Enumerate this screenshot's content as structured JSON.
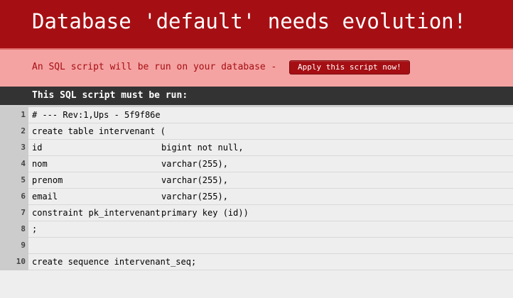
{
  "header": {
    "title": "Database 'default' needs evolution!"
  },
  "notice": {
    "message": "An SQL script will be run on your database -",
    "apply_button_label": "Apply this script now!"
  },
  "script": {
    "title": "This SQL script must be run:",
    "lines": [
      {
        "number": "1",
        "text": "# --- Rev:1,Ups - 5f9f86e",
        "col2": ""
      },
      {
        "number": "2",
        "text": "create table intervenant (",
        "col2": ""
      },
      {
        "number": "3",
        "text": "id",
        "col2": "bigint not null,"
      },
      {
        "number": "4",
        "text": "nom",
        "col2": "varchar(255),"
      },
      {
        "number": "5",
        "text": "prenom",
        "col2": "varchar(255),"
      },
      {
        "number": "6",
        "text": "email",
        "col2": "varchar(255),"
      },
      {
        "number": "7",
        "text": "constraint pk_intervenant",
        "col2": "primary key (id))"
      },
      {
        "number": "8",
        "text": ";",
        "col2": ""
      },
      {
        "number": "9",
        "text": "",
        "col2": ""
      },
      {
        "number": "10",
        "text": "create sequence intervenant_seq;",
        "col2": ""
      }
    ]
  },
  "colors": {
    "header_bg": "#a50f13",
    "notice_bg": "#f5a2a2",
    "script_header_bg": "#333333",
    "line_number_bg": "#cccccc",
    "code_bg": "#eeeeee"
  }
}
